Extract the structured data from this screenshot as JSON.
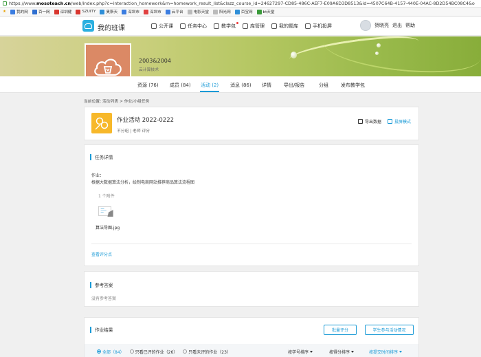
{
  "browser": {
    "url_prefix": "https://www.",
    "url_domain": "mosoteach.cn",
    "url_rest": "/web/index.php?c=interaction_homework&m=homework_result_list&clazz_course_id=24627297-CD85-486C-AEF7-E09A6D3D8513&id=4507C64B-4157-440E-04AC-8D2D54BC08C4&o",
    "bookmarks": [
      "我的网",
      "百一网",
      "深圳健",
      "SZUITY",
      "奥斯天",
      "深圳市",
      "深圳市",
      "云平台",
      "电影天堂",
      "阳光网",
      "百宝网",
      "bt天堂"
    ]
  },
  "header": {
    "logo": "我的班课",
    "nav": [
      "公开课",
      "任务中心",
      "教学包",
      "库管理",
      "我的题库",
      "手机投屏"
    ],
    "user_name": "贺晓亮",
    "logout": "退出",
    "help": "帮助"
  },
  "course": {
    "title": "2003&2004",
    "subtitle": "云计算技术"
  },
  "tabs": [
    "资源 (76)",
    "成员 (84)",
    "活动 (2)",
    "消息 (86)",
    "详情",
    "导出/报告",
    "分组",
    "发布教学包"
  ],
  "breadcrumb": "当前位置: 活动列表 > 作业/小组任务",
  "activity": {
    "title": "作业活动 2022-0222",
    "meta": "不分组 | 老师 评分",
    "export": "导出数据",
    "screen": "投屏模式"
  },
  "task": {
    "section": "任务详情",
    "label": "作业：",
    "content": "根据大数据算法分析，绘制电商网站推荐商品算法流程图",
    "attach_count": "1 个附件",
    "file_name": "算法导图.jpg",
    "view_scores": "查看评分点"
  },
  "answer": {
    "section": "参考答案",
    "empty": "没有参考答案"
  },
  "results": {
    "section": "作业结果",
    "btn_batch": "批量评分",
    "btn_student": "学生参与活动情况",
    "filters": [
      "全部（84）",
      "只看已评的作业（26）",
      "只看未评的作业（23）"
    ],
    "sorts": [
      "按学号排序",
      "按得分排序",
      "按提交时间排序"
    ]
  },
  "colors": {
    "accent": "#1a9ad6",
    "thumb": "#db8965",
    "activity_icon": "#f7b82a"
  }
}
